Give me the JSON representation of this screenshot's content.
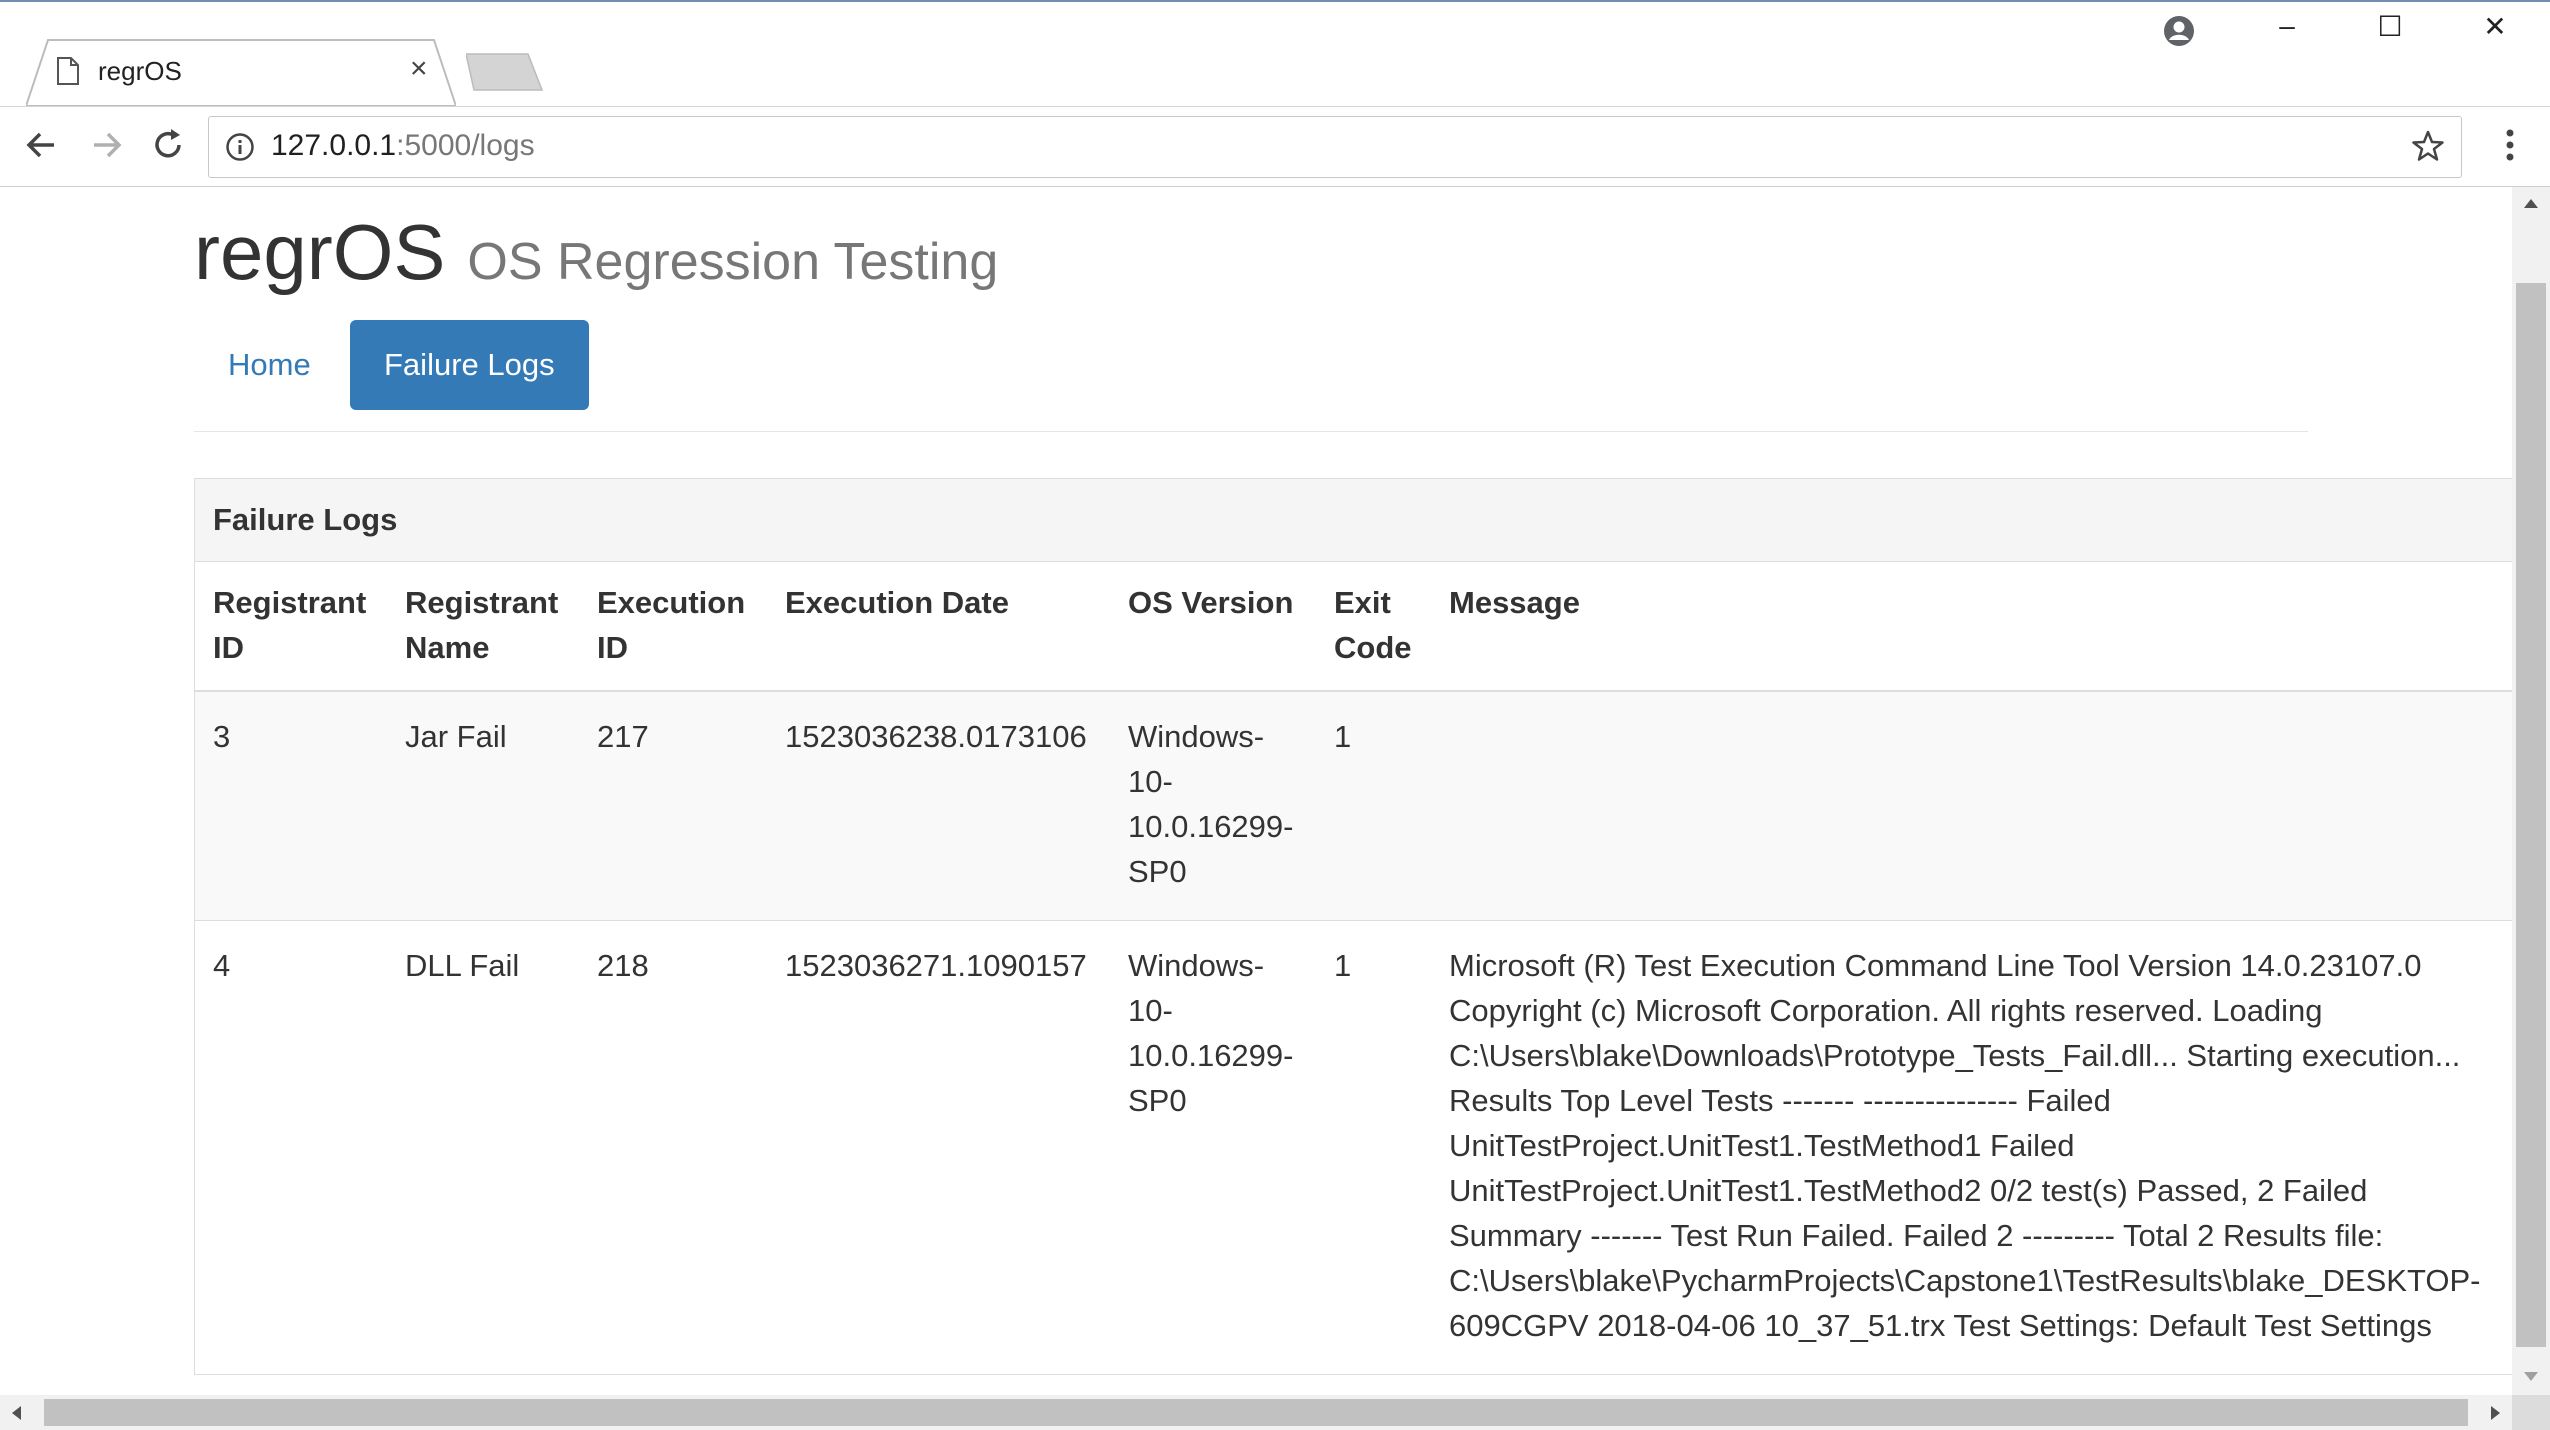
{
  "browser": {
    "tab_title": "regrOS",
    "tab_close_glyph": "×",
    "url_host": "127.0.0.1",
    "url_rest": ":5000/logs",
    "window_controls": {
      "minimize": "–",
      "maximize": "☐",
      "close": "✕"
    },
    "icons": [
      "page-icon",
      "back-arrow-icon",
      "forward-arrow-icon",
      "reload-icon",
      "info-icon",
      "star-icon",
      "menu-dots-icon",
      "account-icon"
    ]
  },
  "header": {
    "brand": "regrOS",
    "subtitle": "OS Regression Testing"
  },
  "nav": {
    "home": "Home",
    "failure_logs": "Failure Logs"
  },
  "panel": {
    "heading": "Failure Logs",
    "columns": [
      "Registrant ID",
      "Registrant Name",
      "Execution ID",
      "Execution Date",
      "OS Version",
      "Exit Code",
      "Message"
    ],
    "rows": [
      {
        "registrant_id": "3",
        "registrant_name": "Jar Fail",
        "execution_id": "217",
        "execution_date": "1523036238.0173106",
        "os_version": "Windows-10-10.0.16299-SP0",
        "exit_code": "1",
        "message": ""
      },
      {
        "registrant_id": "4",
        "registrant_name": "DLL Fail",
        "execution_id": "218",
        "execution_date": "1523036271.1090157",
        "os_version": "Windows-10-10.0.16299-SP0",
        "exit_code": "1",
        "message": "Microsoft (R) Test Execution Command Line Tool Version 14.0.23107.0 Copyright (c) Microsoft Corporation. All rights reserved. Loading C:\\Users\\blake\\Downloads\\Prototype_Tests_Fail.dll... Starting execution... Results Top Level Tests ------- --------------- Failed UnitTestProject.UnitTest1.TestMethod1 Failed UnitTestProject.UnitTest1.TestMethod2 0/2 test(s) Passed, 2 Failed Summary ------- Test Run Failed. Failed 2 --------- Total 2 Results file: C:\\Users\\blake\\PycharmProjects\\Capstone1\\TestResults\\blake_DESKTOP-609CGPV 2018-04-06 10_37_51.trx Test Settings: Default Test Settings"
      }
    ]
  }
}
